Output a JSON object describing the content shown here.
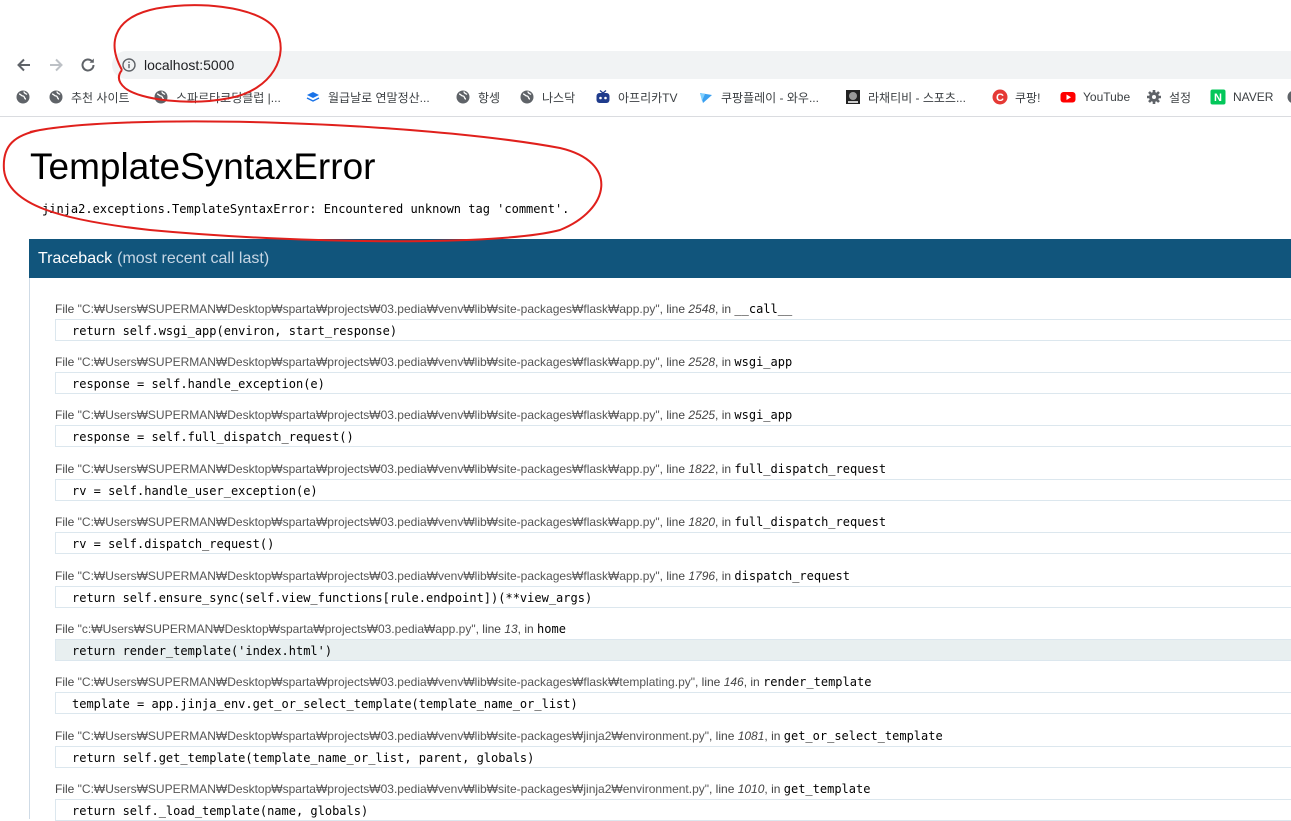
{
  "browser": {
    "url": "localhost:5000",
    "bookmarks": [
      {
        "label": "추천 사이트",
        "icon": "globe-icon"
      },
      {
        "label": "스파르타코딩클럽 |...",
        "icon": "globe-icon"
      },
      {
        "label": "월급날로 연말정산...",
        "icon": "layers-icon"
      },
      {
        "label": "항셍",
        "icon": "globe-icon"
      },
      {
        "label": "나스닥",
        "icon": "globe-icon"
      },
      {
        "label": "아프리카TV",
        "icon": "tv-icon"
      },
      {
        "label": "쿠팡플레이 - 와우...",
        "icon": "play-icon"
      },
      {
        "label": "라채티비 - 스포츠...",
        "icon": "image-icon"
      },
      {
        "label": "쿠팡!",
        "icon": "coupang-icon"
      },
      {
        "label": "YouTube",
        "icon": "youtube-icon"
      },
      {
        "label": "설정",
        "icon": "gear-icon"
      },
      {
        "label": "NAVER",
        "icon": "naver-icon"
      }
    ]
  },
  "colors": {
    "traceback_header": "#11557c",
    "annotation": "#e0201c"
  },
  "error": {
    "title": "TemplateSyntaxError",
    "message": "jinja2.exceptions.TemplateSyntaxError: Encountered unknown tag 'comment'."
  },
  "traceback": {
    "title": "Traceback",
    "subtitle": "(most recent call last)",
    "frames": [
      {
        "file": "\"C:₩Users₩SUPERMAN₩Desktop₩sparta₩projects₩03.pedia₩venv₩lib₩site-packages₩flask₩app.py\"",
        "line": "2548",
        "func": "__call__",
        "code": "return self.wsgi_app(environ, start_response)"
      },
      {
        "file": "\"C:₩Users₩SUPERMAN₩Desktop₩sparta₩projects₩03.pedia₩venv₩lib₩site-packages₩flask₩app.py\"",
        "line": "2528",
        "func": "wsgi_app",
        "code": "response = self.handle_exception(e)"
      },
      {
        "file": "\"C:₩Users₩SUPERMAN₩Desktop₩sparta₩projects₩03.pedia₩venv₩lib₩site-packages₩flask₩app.py\"",
        "line": "2525",
        "func": "wsgi_app",
        "code": "response = self.full_dispatch_request()"
      },
      {
        "file": "\"C:₩Users₩SUPERMAN₩Desktop₩sparta₩projects₩03.pedia₩venv₩lib₩site-packages₩flask₩app.py\"",
        "line": "1822",
        "func": "full_dispatch_request",
        "code": "rv = self.handle_user_exception(e)"
      },
      {
        "file": "\"C:₩Users₩SUPERMAN₩Desktop₩sparta₩projects₩03.pedia₩venv₩lib₩site-packages₩flask₩app.py\"",
        "line": "1820",
        "func": "full_dispatch_request",
        "code": "rv = self.dispatch_request()"
      },
      {
        "file": "\"C:₩Users₩SUPERMAN₩Desktop₩sparta₩projects₩03.pedia₩venv₩lib₩site-packages₩flask₩app.py\"",
        "line": "1796",
        "func": "dispatch_request",
        "code": "return self.ensure_sync(self.view_functions[rule.endpoint])(**view_args)"
      },
      {
        "file": "\"c:₩Users₩SUPERMAN₩Desktop₩sparta₩projects₩03.pedia₩app.py\"",
        "line": "13",
        "func": "home",
        "code": "return render_template('index.html')",
        "current": true
      },
      {
        "file": "\"C:₩Users₩SUPERMAN₩Desktop₩sparta₩projects₩03.pedia₩venv₩lib₩site-packages₩flask₩templating.py\"",
        "line": "146",
        "func": "render_template",
        "code": "template = app.jinja_env.get_or_select_template(template_name_or_list)"
      },
      {
        "file": "\"C:₩Users₩SUPERMAN₩Desktop₩sparta₩projects₩03.pedia₩venv₩lib₩site-packages₩jinja2₩environment.py\"",
        "line": "1081",
        "func": "get_or_select_template",
        "code": "return self.get_template(template_name_or_list, parent, globals)"
      },
      {
        "file": "\"C:₩Users₩SUPERMAN₩Desktop₩sparta₩projects₩03.pedia₩venv₩lib₩site-packages₩jinja2₩environment.py\"",
        "line": "1010",
        "func": "get_template",
        "code": "return self._load_template(name, globals)"
      }
    ]
  },
  "labels": {
    "file_prefix": "File ",
    "line_prefix": ", line ",
    "in_prefix": ", in "
  }
}
